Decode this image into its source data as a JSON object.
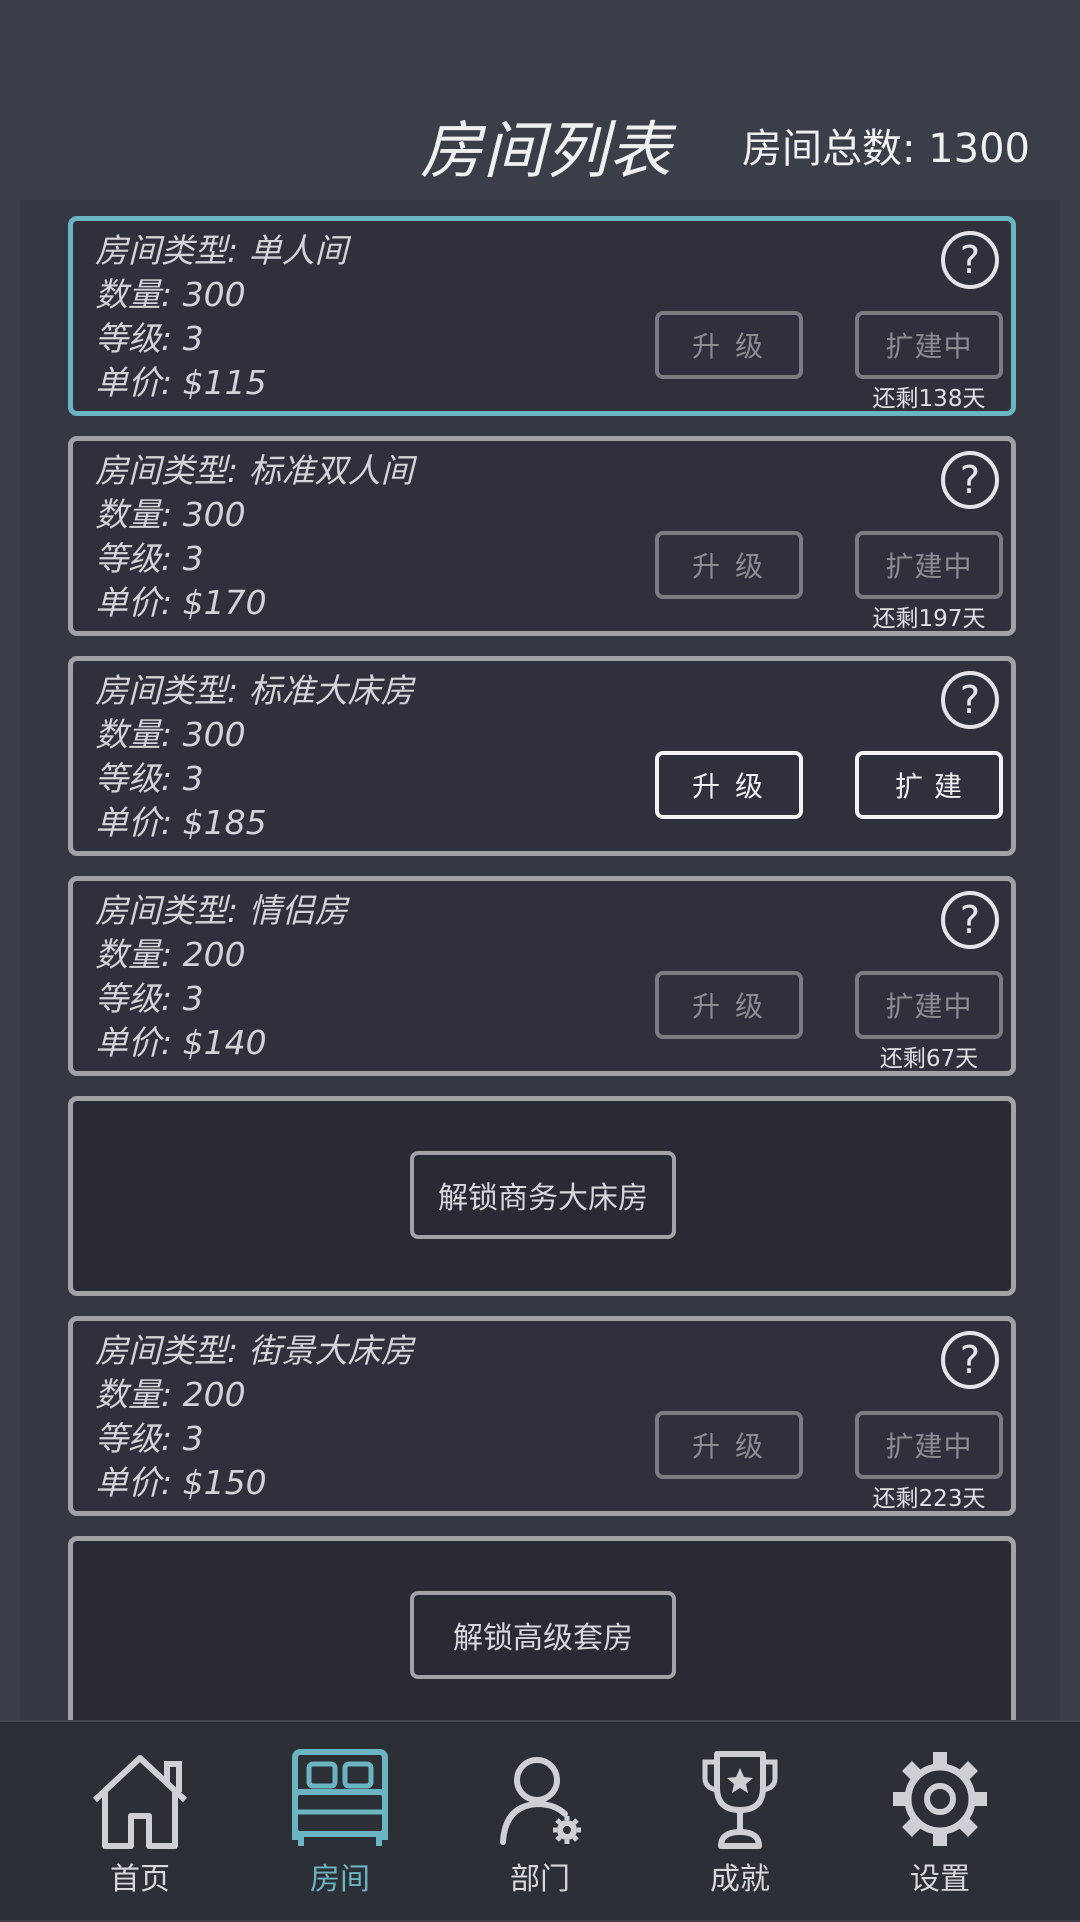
{
  "header": {
    "title": "房间列表",
    "room_total": "房间总数: 1300"
  },
  "rooms": [
    {
      "type": "房间类型: 单人间",
      "count": "数量: 300",
      "level": "等级: 3",
      "price": "单价: $115",
      "upgrade": "升 级",
      "expand": "扩建中",
      "remain": "还剩138天"
    },
    {
      "type": "房间类型: 标准双人间",
      "count": "数量: 300",
      "level": "等级: 3",
      "price": "单价: $170",
      "upgrade": "升 级",
      "expand": "扩建中",
      "remain": "还剩197天"
    },
    {
      "type": "房间类型: 标准大床房",
      "count": "数量: 300",
      "level": "等级: 3",
      "price": "单价: $185",
      "upgrade": "升 级",
      "expand": "扩 建"
    },
    {
      "type": "房间类型: 情侣房",
      "count": "数量: 200",
      "level": "等级: 3",
      "price": "单价: $140",
      "upgrade": "升 级",
      "expand": "扩建中",
      "remain": "还剩67天"
    },
    {
      "unlock": "解锁商务大床房"
    },
    {
      "type": "房间类型: 街景大床房",
      "count": "数量: 200",
      "level": "等级: 3",
      "price": "单价: $150",
      "upgrade": "升 级",
      "expand": "扩建中",
      "remain": "还剩223天"
    },
    {
      "unlock": "解锁高级套房"
    }
  ],
  "help_glyph": "?",
  "nav": {
    "home": "首页",
    "rooms": "房间",
    "department": "部门",
    "achievements": "成就",
    "settings": "设置"
  },
  "colors": {
    "background": "#3a3e48",
    "card": "#2f303b",
    "accent": "#6bb5c2",
    "border": "#a3a3a7"
  }
}
